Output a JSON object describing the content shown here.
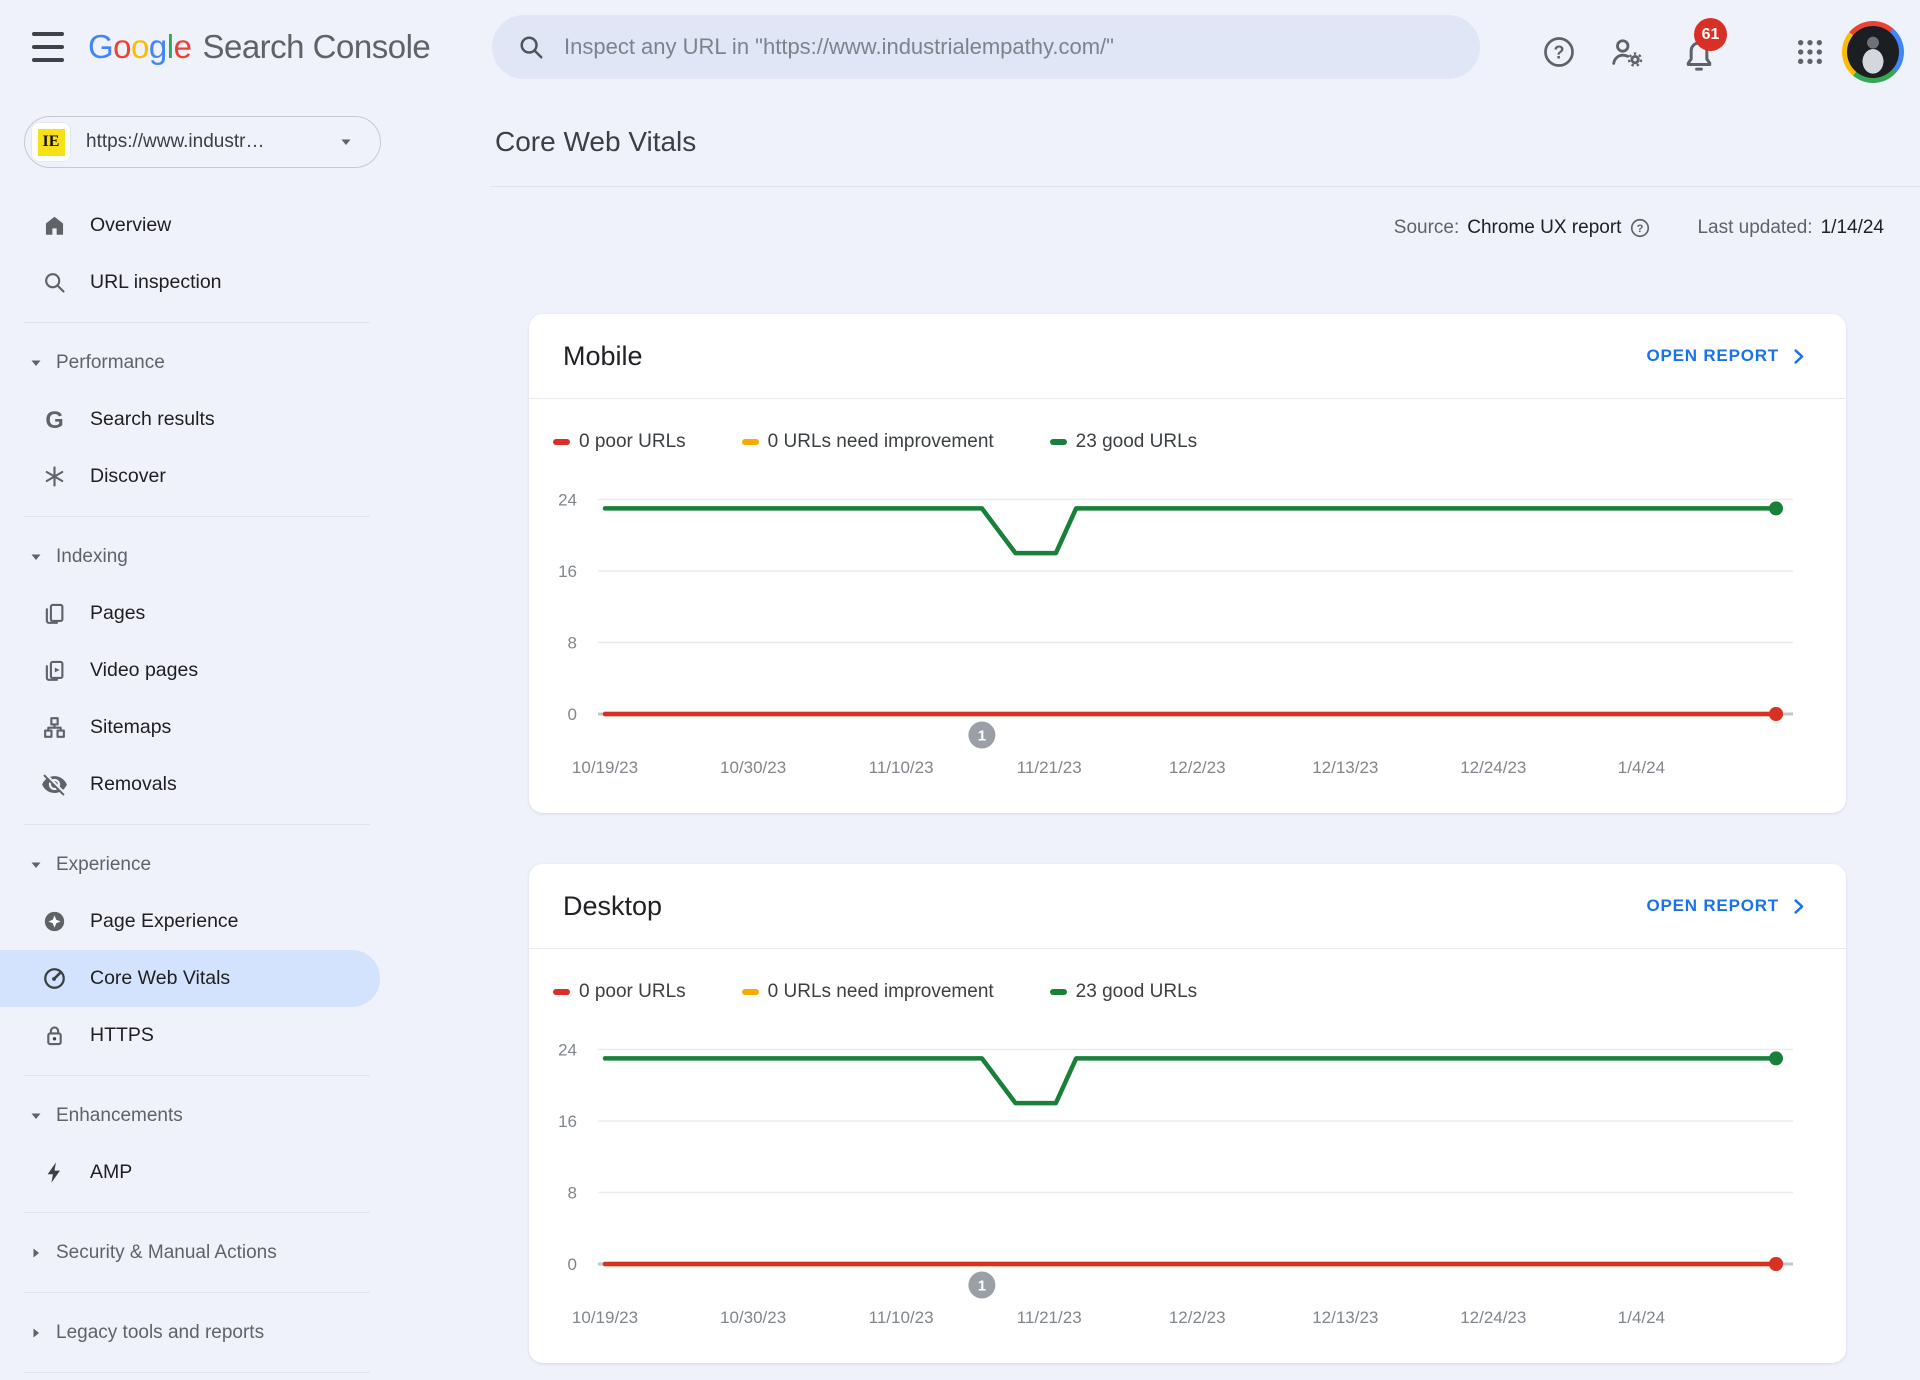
{
  "colors": {
    "accent_blue": "#1a73e8",
    "badge_red": "#d93025",
    "selected_nav_bg": "#d3e3fd",
    "good_green": "#188038",
    "poor_red": "#d93025",
    "improvement_orange": "#f9ab00"
  },
  "header": {
    "brand": "Google",
    "product": "Search Console",
    "search": {
      "placeholder": "Inspect any URL in \"https://www.industrialempathy.com/\""
    },
    "notifications_count": "61"
  },
  "sidebar": {
    "property": {
      "icon_text": "IE",
      "icon_bg": "#f7e017",
      "label": "https://www.industr…"
    },
    "items": [
      {
        "kind": "item",
        "id": "overview",
        "icon": "home",
        "label": "Overview"
      },
      {
        "kind": "item",
        "id": "url-inspection",
        "icon": "search",
        "label": "URL inspection"
      },
      {
        "kind": "divider"
      },
      {
        "kind": "section",
        "id": "performance",
        "label": "Performance",
        "expanded": true
      },
      {
        "kind": "item",
        "id": "search-results",
        "icon": "google-g",
        "label": "Search results"
      },
      {
        "kind": "item",
        "id": "discover",
        "icon": "asterisk",
        "label": "Discover"
      },
      {
        "kind": "divider"
      },
      {
        "kind": "section",
        "id": "indexing",
        "label": "Indexing",
        "expanded": true
      },
      {
        "kind": "item",
        "id": "pages",
        "icon": "pages",
        "label": "Pages"
      },
      {
        "kind": "item",
        "id": "video-pages",
        "icon": "video-pages",
        "label": "Video pages"
      },
      {
        "kind": "item",
        "id": "sitemaps",
        "icon": "sitemaps",
        "label": "Sitemaps"
      },
      {
        "kind": "item",
        "id": "removals",
        "icon": "eye-off",
        "label": "Removals"
      },
      {
        "kind": "divider"
      },
      {
        "kind": "section",
        "id": "experience",
        "label": "Experience",
        "expanded": true
      },
      {
        "kind": "item",
        "id": "page-experience",
        "icon": "page-experience",
        "label": "Page Experience"
      },
      {
        "kind": "item",
        "id": "core-web-vitals",
        "icon": "speedometer",
        "label": "Core Web Vitals",
        "selected": true
      },
      {
        "kind": "item",
        "id": "https",
        "icon": "lock",
        "label": "HTTPS"
      },
      {
        "kind": "divider"
      },
      {
        "kind": "section",
        "id": "enhancements",
        "label": "Enhancements",
        "expanded": true
      },
      {
        "kind": "item",
        "id": "amp",
        "icon": "bolt",
        "label": "AMP"
      },
      {
        "kind": "divider"
      },
      {
        "kind": "section",
        "id": "security-manual-actions",
        "label": "Security & Manual Actions",
        "expanded": false
      },
      {
        "kind": "divider"
      },
      {
        "kind": "section",
        "id": "legacy-tools",
        "label": "Legacy tools and reports",
        "expanded": false
      },
      {
        "kind": "divider"
      }
    ]
  },
  "page": {
    "title": "Core Web Vitals",
    "source_label": "Source:",
    "source_value": "Chrome UX report",
    "last_updated_label": "Last updated:",
    "last_updated_value": "1/14/24"
  },
  "cards": [
    {
      "id": "mobile",
      "title": "Mobile",
      "action": "OPEN REPORT",
      "legend": [
        {
          "label": "0 poor URLs",
          "color": "#d93025"
        },
        {
          "label": "0 URLs need improvement",
          "color": "#f9ab00"
        },
        {
          "label": "23 good URLs",
          "color": "#188038"
        }
      ]
    },
    {
      "id": "desktop",
      "title": "Desktop",
      "action": "OPEN REPORT",
      "legend": [
        {
          "label": "0 poor URLs",
          "color": "#d93025"
        },
        {
          "label": "0 URLs need improvement",
          "color": "#f9ab00"
        },
        {
          "label": "23 good URLs",
          "color": "#188038"
        }
      ]
    }
  ],
  "chart_data": [
    {
      "type": "line",
      "title": "Mobile Core Web Vitals URL counts over time",
      "x_axis": {
        "kind": "date",
        "start_date": "10/19/23",
        "end_date": "1/14/24",
        "total_days": 87,
        "tick_days": [
          0,
          11,
          22,
          33,
          44,
          55,
          66,
          77
        ],
        "tick_labels": [
          "10/19/23",
          "10/30/23",
          "11/10/23",
          "11/21/23",
          "12/2/23",
          "12/13/23",
          "12/24/23",
          "1/4/24"
        ]
      },
      "y_axis": {
        "ticks": [
          0,
          8,
          16,
          24
        ],
        "min": 0,
        "max": 24,
        "grid": true
      },
      "series": [
        {
          "name": "good URLs",
          "current_count": 23,
          "color": "#188038",
          "points_day_value": [
            [
              0,
              23
            ],
            [
              28,
              23
            ],
            [
              30.5,
              18
            ],
            [
              33.5,
              18
            ],
            [
              35,
              23
            ],
            [
              87,
              23
            ]
          ]
        },
        {
          "name": "URLs need improvement",
          "current_count": 0,
          "color": "#f9ab00",
          "points_day_value": [
            [
              0,
              0
            ],
            [
              87,
              0
            ]
          ]
        },
        {
          "name": "poor URLs",
          "current_count": 0,
          "color": "#d93025",
          "points_day_value": [
            [
              0,
              0
            ],
            [
              87,
              0
            ]
          ]
        }
      ],
      "annotations": [
        {
          "label": "1",
          "day": 28
        }
      ],
      "legend_position": "top"
    },
    {
      "type": "line",
      "title": "Desktop Core Web Vitals URL counts over time",
      "x_axis": {
        "kind": "date",
        "start_date": "10/19/23",
        "end_date": "1/14/24",
        "total_days": 87,
        "tick_days": [
          0,
          11,
          22,
          33,
          44,
          55,
          66,
          77
        ],
        "tick_labels": [
          "10/19/23",
          "10/30/23",
          "11/10/23",
          "11/21/23",
          "12/2/23",
          "12/13/23",
          "12/24/23",
          "1/4/24"
        ]
      },
      "y_axis": {
        "ticks": [
          0,
          8,
          16,
          24
        ],
        "min": 0,
        "max": 24,
        "grid": true
      },
      "series": [
        {
          "name": "good URLs",
          "current_count": 23,
          "color": "#188038",
          "points_day_value": [
            [
              0,
              23
            ],
            [
              28,
              23
            ],
            [
              30.5,
              18
            ],
            [
              33.5,
              18
            ],
            [
              35,
              23
            ],
            [
              87,
              23
            ]
          ]
        },
        {
          "name": "URLs need improvement",
          "current_count": 0,
          "color": "#f9ab00",
          "points_day_value": [
            [
              0,
              0
            ],
            [
              87,
              0
            ]
          ]
        },
        {
          "name": "poor URLs",
          "current_count": 0,
          "color": "#d93025",
          "points_day_value": [
            [
              0,
              0
            ],
            [
              87,
              0
            ]
          ]
        }
      ],
      "annotations": [
        {
          "label": "1",
          "day": 28
        }
      ],
      "legend_position": "top"
    }
  ]
}
